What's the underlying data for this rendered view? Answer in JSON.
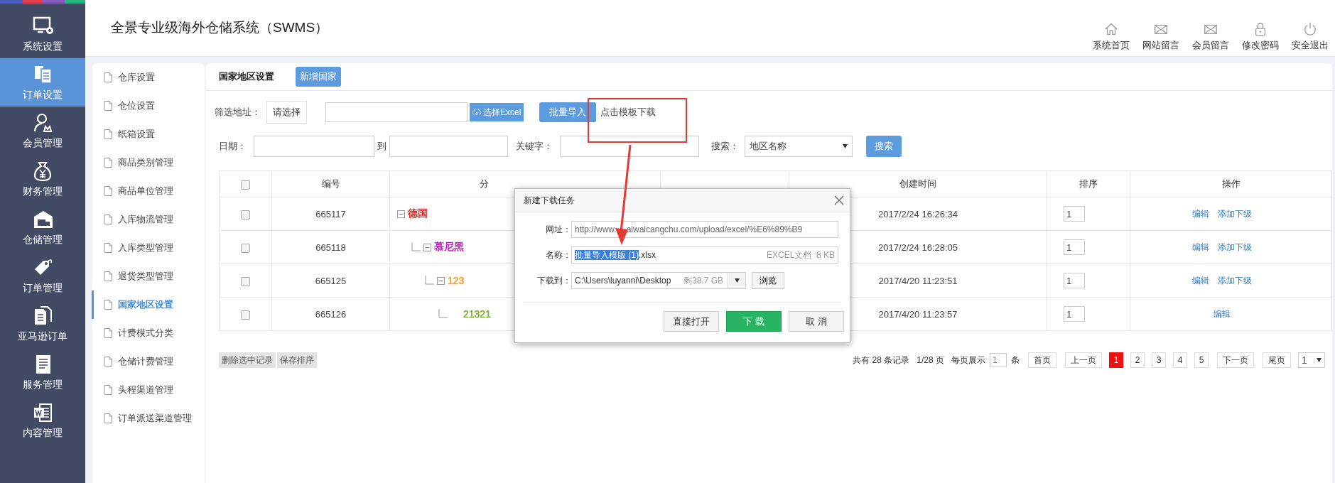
{
  "nav": {
    "items": [
      {
        "label": "系统设置",
        "selected": false
      },
      {
        "label": "订单设置",
        "selected": true
      },
      {
        "label": "会员管理",
        "selected": false
      },
      {
        "label": "财务管理",
        "selected": false
      },
      {
        "label": "仓储管理",
        "selected": false
      },
      {
        "label": "订单管理",
        "selected": false
      },
      {
        "label": "亚马逊订单",
        "selected": false
      },
      {
        "label": "服务管理",
        "selected": false
      },
      {
        "label": "内容管理",
        "selected": false
      }
    ]
  },
  "header": {
    "title": "全景专业级海外仓储系统（SWMS）",
    "links": [
      {
        "label": "系统首页"
      },
      {
        "label": "网站留言"
      },
      {
        "label": "会员留言"
      },
      {
        "label": "修改密码"
      },
      {
        "label": "安全退出"
      }
    ]
  },
  "subnav": {
    "items": [
      {
        "label": "仓库设置",
        "selected": false
      },
      {
        "label": "仓位设置",
        "selected": false
      },
      {
        "label": "纸箱设置",
        "selected": false
      },
      {
        "label": "商品类别管理",
        "selected": false
      },
      {
        "label": "商品单位管理",
        "selected": false
      },
      {
        "label": "入库物流管理",
        "selected": false
      },
      {
        "label": "入库类型管理",
        "selected": false
      },
      {
        "label": "退货类型管理",
        "selected": false
      },
      {
        "label": "国家地区设置",
        "selected": true
      },
      {
        "label": "计费模式分类",
        "selected": false
      },
      {
        "label": "仓储计费管理",
        "selected": false
      },
      {
        "label": "头程渠道管理",
        "selected": false
      },
      {
        "label": "订单派送渠道管理",
        "selected": false
      }
    ]
  },
  "panel": {
    "title": "国家地区设置",
    "add_button": "新增国家"
  },
  "filters": {
    "address_label": "筛选地址：",
    "address_button": "请选择",
    "excel_button": "选择Excel",
    "import_button": "批量导入",
    "template_link": "点击模板下载",
    "date_label": "日期：",
    "date_to": "到",
    "keyword_label": "关键字：",
    "search_label": "搜索：",
    "search_select": "地区名称",
    "search_button": "搜索"
  },
  "table": {
    "header_checked": false,
    "columns": [
      "编号",
      "分",
      "创建时间",
      "排序",
      "操作"
    ],
    "rows": [
      {
        "id": "665117",
        "name": "德国",
        "color": "#e02020",
        "expanded": true,
        "checked": false,
        "created": "2017/2/24 16:26:34",
        "sort": "1",
        "actions": [
          "编辑",
          "添加下级"
        ],
        "children": [
          {
            "id": "665118",
            "name": "慕尼黑",
            "color": "#c020c0",
            "expanded": true,
            "checked": false,
            "created": "2017/2/24 16:28:05",
            "sort": "1",
            "actions": [
              "编辑",
              "添加下级"
            ],
            "children": [
              {
                "id": "665125",
                "name": "123",
                "color": "#f0a020",
                "expanded": true,
                "checked": false,
                "created": "2017/4/20 11:23:51",
                "sort": "1",
                "actions": [
                  "编辑",
                  "添加下级"
                ],
                "children": [
                  {
                    "id": "665126",
                    "name": "21321",
                    "color": "#80b030",
                    "checked": false,
                    "created": "2017/4/20 11:23:57",
                    "sort": "1",
                    "actions": [
                      "编辑"
                    ]
                  }
                ]
              }
            ]
          }
        ]
      }
    ]
  },
  "bulk_buttons": [
    "删除选中记录",
    "保存排序"
  ],
  "pagination": {
    "total": "共有 28 条记录",
    "pages": "1/28 页",
    "per_page_label": "每页展示",
    "per_page_value": "1",
    "per_page_unit": "条",
    "first": "首页",
    "prev": "上一页",
    "page_numbers": [
      {
        "label": "1",
        "selected": true
      },
      {
        "label": "2",
        "selected": false
      },
      {
        "label": "3",
        "selected": false
      },
      {
        "label": "4",
        "selected": false
      },
      {
        "label": "5",
        "selected": false
      }
    ],
    "next": "下一页",
    "last": "尾页",
    "jump_select": "1"
  },
  "dialog": {
    "title": "新建下载任务",
    "url_label": "网址：",
    "url_parts": [
      "http://www.",
      "aiwaicangchu.com/upload/excel/%E6%89%B9"
    ],
    "name_label": "名称：",
    "name_parts": [
      {
        "text": "批量导入模版 (1)",
        "selected": true
      },
      {
        "text": ".xlsx",
        "selected": false
      }
    ],
    "file_info": "EXCEL文档  8 KB",
    "dest_label": "下载到：",
    "dest_path": "C:\\Users\\luyanni\\Desktop",
    "free_space": "剩38.7 GB",
    "browse_button": "浏览",
    "buttons": [
      {
        "label": "直接打开",
        "kind": "plain"
      },
      {
        "label": "下 载",
        "kind": "primary"
      },
      {
        "label": "取 消",
        "kind": "plain"
      }
    ]
  }
}
